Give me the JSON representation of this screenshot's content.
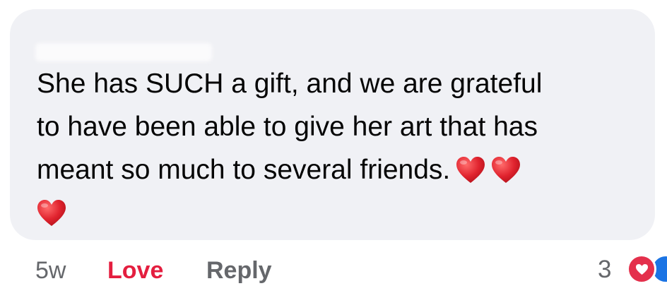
{
  "comment": {
    "text_lines": [
      "She has SUCH a gift, and we are grateful",
      "to have been able to give her art that has",
      "meant so much to several friends."
    ],
    "emoji": [
      "red-heart",
      "red-heart",
      "red-heart"
    ]
  },
  "footer": {
    "timestamp": "5w",
    "love_label": "Love",
    "reply_label": "Reply",
    "reaction_count": "3"
  },
  "colors": {
    "bubble": "#f0f1f5",
    "text": "#050505",
    "muted": "#65676b",
    "love": "#e41e3f",
    "heart": "#e0232e",
    "like_blue": "#1b74e4"
  },
  "icons": {
    "reactions": [
      "love-reaction-icon",
      "like-reaction-icon"
    ]
  }
}
